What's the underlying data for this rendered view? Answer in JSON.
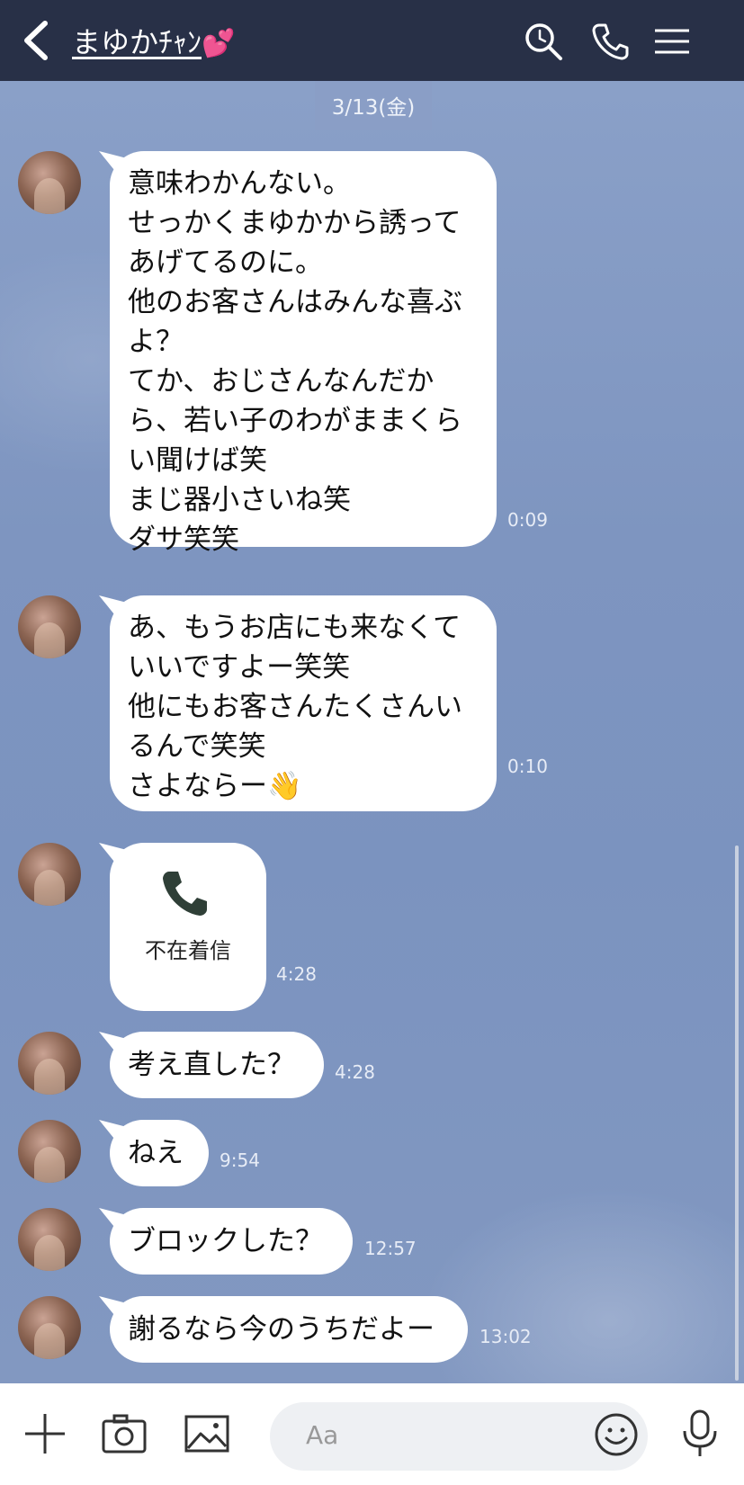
{
  "header": {
    "contact_name": "まゆかﾁｬﾝ",
    "hearts": "💕",
    "icons": [
      "back-chevron-icon",
      "search-icon",
      "phone-icon",
      "menu-icon"
    ]
  },
  "chat": {
    "date_label": "3/13(金)",
    "messages": [
      {
        "type": "text",
        "lines": [
          "意味わかんない。",
          "せっかくまゆかから誘って",
          "あげてるのに。",
          "他のお客さんはみんな喜ぶ",
          "よ？",
          "てか、おじさんなんだか",
          "ら、若い子のわがままくら",
          "い聞けば笑",
          "まじ器小さいね笑",
          "ダサ笑笑"
        ],
        "time": "0:09"
      },
      {
        "type": "text",
        "lines": [
          "あ、もうお店にも来なくて",
          "いいですよー笑笑",
          "他にもお客さんたくさんい",
          "るんで笑笑",
          "さよならー👋"
        ],
        "time": "0:10"
      },
      {
        "type": "missed_call",
        "label": "不在着信",
        "icon": "phone-icon",
        "time": "4:28"
      },
      {
        "type": "text",
        "lines": [
          "考え直した？"
        ],
        "time": "4:28"
      },
      {
        "type": "text",
        "lines": [
          "ねえ"
        ],
        "time": "9:54"
      },
      {
        "type": "text",
        "lines": [
          "ブロックした？"
        ],
        "time": "12:57"
      },
      {
        "type": "text",
        "lines": [
          "謝るなら今のうちだよー"
        ],
        "time": "13:02"
      }
    ]
  },
  "footer": {
    "input_placeholder": "Aa",
    "icons": [
      "plus-icon",
      "camera-icon",
      "image-icon",
      "emoji-icon",
      "microphone-icon"
    ]
  },
  "colors": {
    "header_bg": "#283047",
    "chat_bg": "#7f96c0",
    "bubble": "#ffffff",
    "heart": "#f25fb2"
  }
}
